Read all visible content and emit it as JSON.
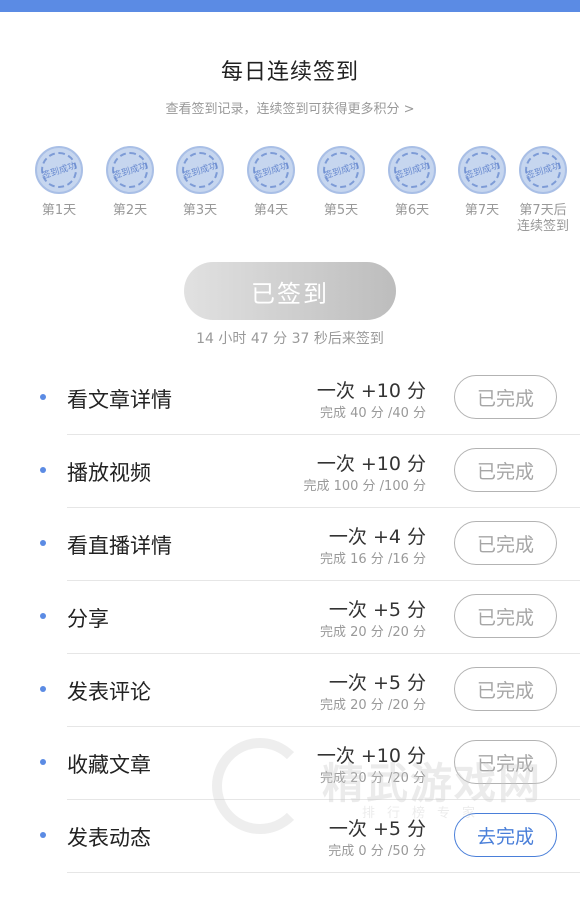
{
  "header": {
    "title": "每日连续签到",
    "subtitle": "查看签到记录，连续签到可获得更多积分 >"
  },
  "days": [
    {
      "label": "第1天",
      "stamp": "签到成功"
    },
    {
      "label": "第2天",
      "stamp": "签到成功"
    },
    {
      "label": "第3天",
      "stamp": "签到成功"
    },
    {
      "label": "第4天",
      "stamp": "签到成功"
    },
    {
      "label": "第5天",
      "stamp": "签到成功"
    },
    {
      "label": "第6天",
      "stamp": "签到成功"
    },
    {
      "label": "第7天",
      "stamp": "签到成功"
    },
    {
      "label": "第7天后\n连续签到",
      "stamp": "签到成功"
    }
  ],
  "checkin": {
    "button_label": "已签到",
    "countdown": "14 小时 47 分 37 秒后来签到"
  },
  "tasks": [
    {
      "name": "看文章详情",
      "reward": "一次 +10 分",
      "progress": "完成 40 分 /40 分",
      "status": "已完成",
      "done": true
    },
    {
      "name": "播放视频",
      "reward": "一次 +10 分",
      "progress": "完成 100 分 /100 分",
      "status": "已完成",
      "done": true
    },
    {
      "name": "看直播详情",
      "reward": "一次 +4 分",
      "progress": "完成 16 分 /16 分",
      "status": "已完成",
      "done": true
    },
    {
      "name": "分享",
      "reward": "一次 +5 分",
      "progress": "完成 20 分 /20 分",
      "status": "已完成",
      "done": true
    },
    {
      "name": "发表评论",
      "reward": "一次 +5 分",
      "progress": "完成 20 分 /20 分",
      "status": "已完成",
      "done": true
    },
    {
      "name": "收藏文章",
      "reward": "一次 +10 分",
      "progress": "完成 20 分 /20 分",
      "status": "已完成",
      "done": true
    },
    {
      "name": "发表动态",
      "reward": "一次 +5 分",
      "progress": "完成 0 分 /50 分",
      "status": "去完成",
      "done": false
    }
  ],
  "watermark": {
    "name": "精武游戏网",
    "tagline": "排行榜专家"
  },
  "colors": {
    "accent": "#5b8be4",
    "stamp": "#c6d6ef",
    "done_border": "#b3b3b3",
    "todo_border": "#4a7fd9"
  }
}
